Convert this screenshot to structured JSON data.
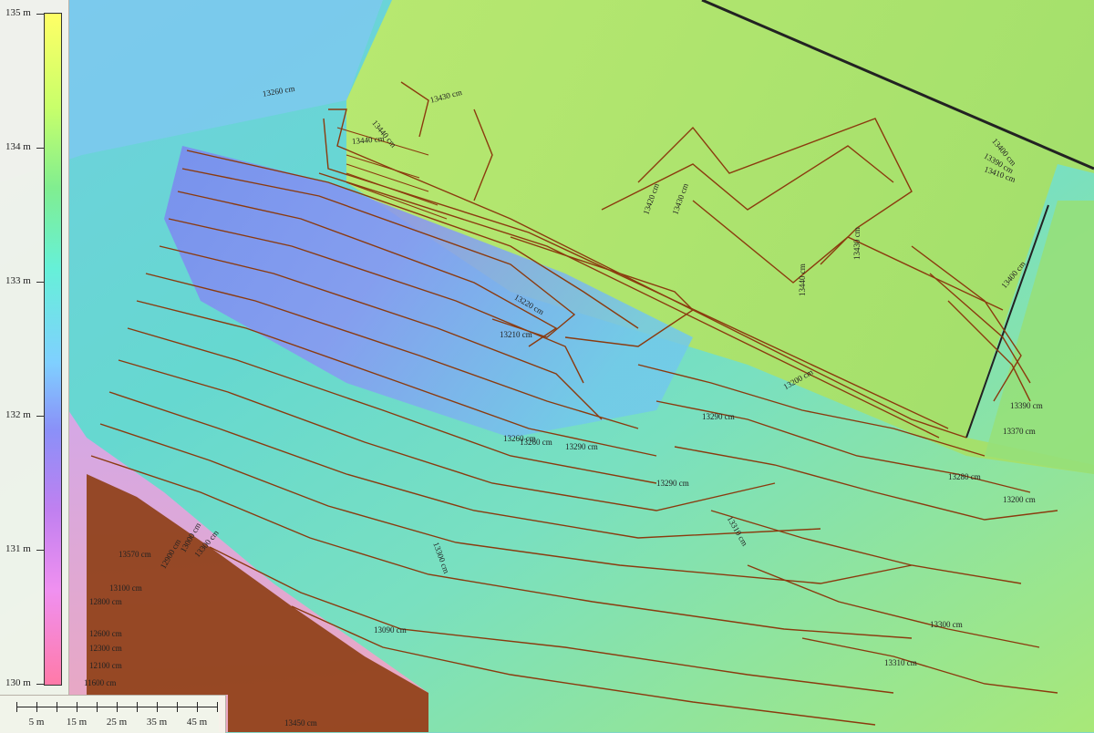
{
  "legend": {
    "ticks": [
      "135 m",
      "134 m",
      "133 m",
      "132 m",
      "131 m",
      "130 m"
    ]
  },
  "scale_bar": {
    "labels": [
      "5 m",
      "15 m",
      "25 m",
      "35 m",
      "45 m"
    ]
  },
  "contour_labels": [
    "13260 cm",
    "13430 cm",
    "13440 cm",
    "13440 cm",
    "13390 cm",
    "13400 cm",
    "13410 cm",
    "13420 cm",
    "13430 cm",
    "13430 cm",
    "13440 cm",
    "13400 cm",
    "13390 cm",
    "13370 cm",
    "13280 cm",
    "13290 cm",
    "13210 cm",
    "13220 cm",
    "13200 cm",
    "13290 cm",
    "13310 cm",
    "13260 cm",
    "13200 cm",
    "13290 cm",
    "13300 cm",
    "13310 cm",
    "13090 cm",
    "13260 cm",
    "13000 cm",
    "12900 cm",
    "12800 cm",
    "12600 cm",
    "12300 cm",
    "12100 cm",
    "11600 cm",
    "13570 cm",
    "13100 cm",
    "13450 cm",
    "13300 cm",
    "13300 cm"
  ],
  "colors": {
    "contour": "#8b3a0e",
    "legend_top": "#ffff66",
    "legend_bottom": "#ff7aa8"
  }
}
